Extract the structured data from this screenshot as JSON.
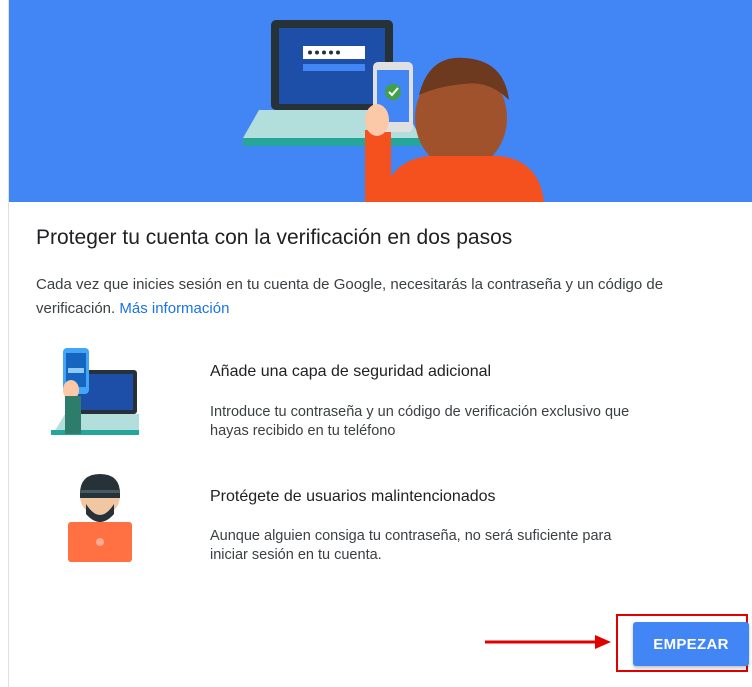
{
  "colors": {
    "accent": "#4285f4",
    "link": "#1a73e8",
    "highlight": "#e00000"
  },
  "card": {
    "title": "Proteger tu cuenta con la verificación en dos pasos",
    "description": "Cada vez que inicies sesión en tu cuenta de Google, necesitarás la contraseña y un código de verificación. ",
    "more_info_link": "Más información"
  },
  "features": [
    {
      "icon": "phone-laptop-icon",
      "title": "Añade una capa de seguridad adicional",
      "text": "Introduce tu contraseña y un código de verificación exclusivo que hayas recibido en tu teléfono"
    },
    {
      "icon": "hacker-icon",
      "title": "Protégete de usuarios malintencionados",
      "text": "Aunque alguien consiga tu contraseña, no será suficiente para iniciar sesión en tu cuenta."
    }
  ],
  "actions": {
    "start_label": "EMPEZAR"
  }
}
